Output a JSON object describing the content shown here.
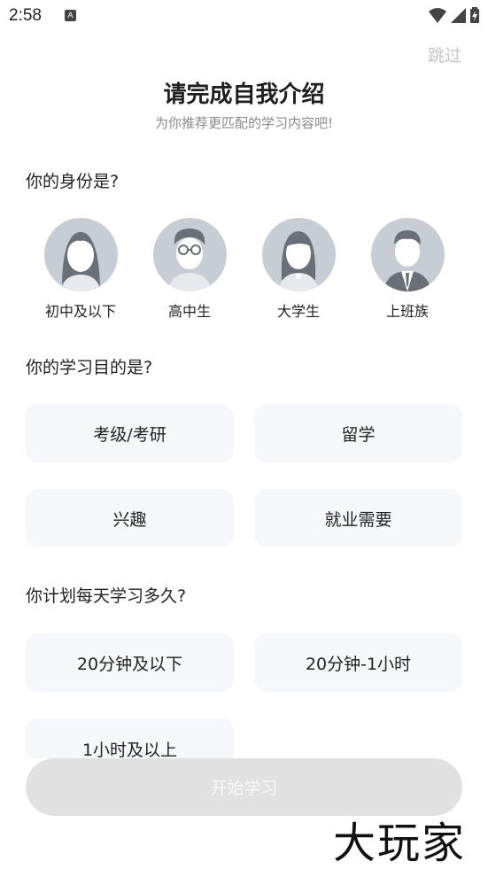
{
  "status_bar": {
    "time": "2:58",
    "notification_icon": "a-notification-icon",
    "wifi_icon": "wifi-icon",
    "signal_icon": "signal-icon",
    "battery_icon": "battery-charging-icon"
  },
  "header": {
    "skip_label": "跳过",
    "title": "请完成自我介绍",
    "subtitle": "为你推荐更匹配的学习内容吧!"
  },
  "identity": {
    "question": "你的身份是?",
    "options": [
      {
        "label": "初中及以下",
        "icon": "girl-avatar-icon"
      },
      {
        "label": "高中生",
        "icon": "boy-glasses-avatar-icon"
      },
      {
        "label": "大学生",
        "icon": "woman-avatar-icon"
      },
      {
        "label": "上班族",
        "icon": "businessman-avatar-icon"
      }
    ]
  },
  "goal": {
    "question": "你的学习目的是?",
    "options": [
      "考级/考研",
      "留学",
      "兴趣",
      "就业需要"
    ]
  },
  "time_plan": {
    "question": "你计划每天学习多久?",
    "options": [
      "20分钟及以下",
      "20分钟-1小时",
      "1小时及以上"
    ]
  },
  "start_button": "开始学习",
  "watermark": "大玩家",
  "colors": {
    "option_bg": "#f6f7fa",
    "avatar_bg": "#c8ccd4",
    "button_disabled_bg": "#e1e1e1",
    "skip_text": "#c4c4c4"
  }
}
